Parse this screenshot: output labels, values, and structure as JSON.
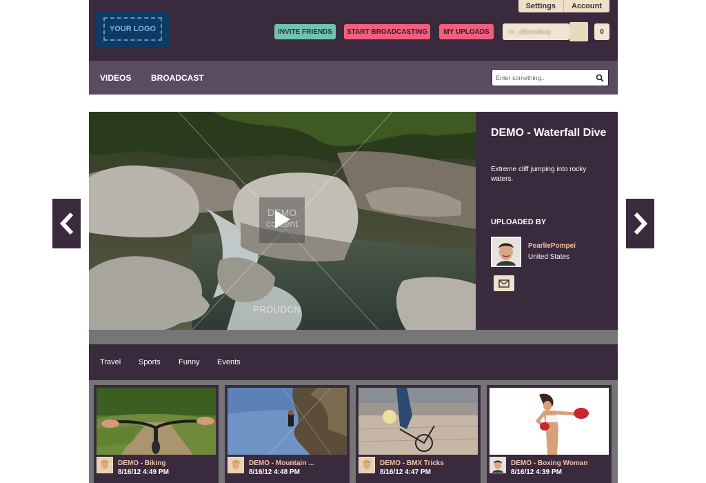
{
  "header": {
    "top_menu": [
      "Settings",
      "Account"
    ],
    "logo_text": "YOUR LOGO",
    "buttons": {
      "invite": "INVITE FRIENDS",
      "broadcast": "START BROADCASTING",
      "uploads": "MY UPLOADS"
    },
    "user_name": "mr_ultfponalbug",
    "notification_count": "0"
  },
  "nav": {
    "items": [
      "VIDEOS",
      "BROADCAST"
    ],
    "search_placeholder": "Enter something.."
  },
  "feature": {
    "title": "DEMO - Waterfall Dive",
    "description": "Extreme cliff jumping into rocky waters.",
    "uploaded_by_label": "UPLOADED BY",
    "uploader_name": "PearliePompei",
    "uploader_country": "United States",
    "watermark": "DEMO content",
    "brand_watermark": "PROUDCN"
  },
  "categories": [
    "Travel",
    "Sports",
    "Funny",
    "Events"
  ],
  "videos": [
    {
      "title": "DEMO - Biking",
      "date": "8/16/12 4:49 PM"
    },
    {
      "title": "DEMO - Mountain ...",
      "date": "8/16/12 4:48 PM"
    },
    {
      "title": "DEMO - BMX Tricks",
      "date": "8/16/12 4:47 PM"
    },
    {
      "title": "DEMO - Boxing Woman",
      "date": "8/16/12 4:39 PM"
    }
  ],
  "colors": {
    "brand_dark": "#3a2a3e",
    "nav": "#5b4b61",
    "cream": "#efe1c6",
    "teal": "#6fc4b0",
    "pink": "#f0607c",
    "logo_blue": "#0f3a63"
  }
}
